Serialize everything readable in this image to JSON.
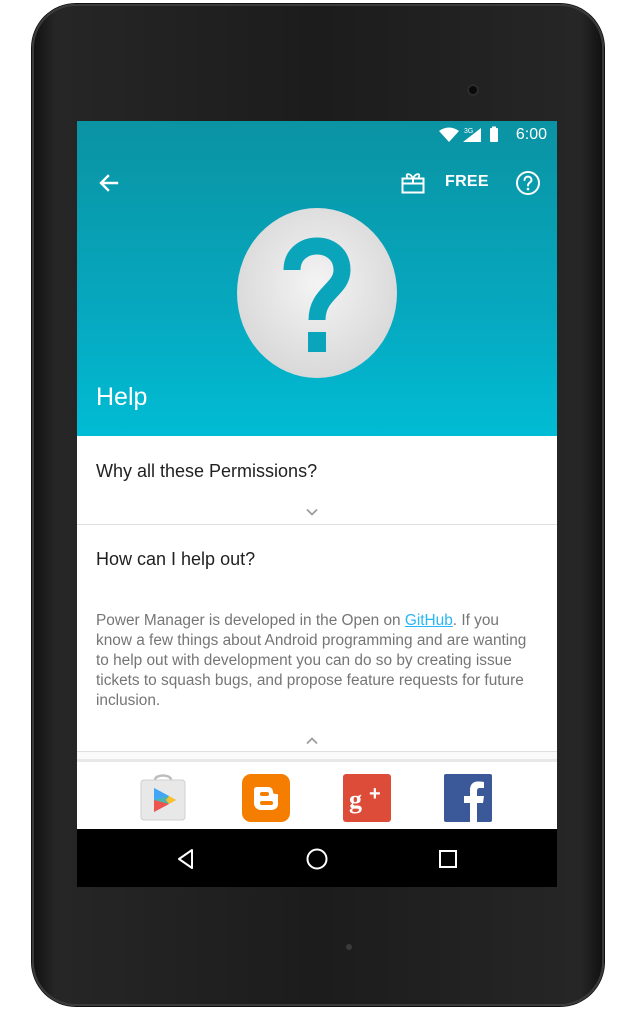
{
  "status_bar": {
    "network_label": "3G",
    "time": "6:00"
  },
  "toolbar": {
    "free_label": "FREE",
    "icons": [
      "back-arrow-icon",
      "gift-icon",
      "help-circle-icon"
    ]
  },
  "header": {
    "title": "Help",
    "hero_icon": "question-mark-icon"
  },
  "faq": [
    {
      "question": "Why all these Permissions?",
      "expanded": false
    },
    {
      "question": "How can I help out?",
      "expanded": true,
      "answer_before_link": "Power Manager is developed in the Open on ",
      "answer_link": "GitHub",
      "answer_after_link": ". If you know a few things about Android programming and are wanting to help out with development you can do so by creating issue tickets to squash bugs, and propose feature requests for future inclusion."
    }
  ],
  "share_apps": [
    "google-play-icon",
    "blogger-icon",
    "google-plus-icon",
    "facebook-icon"
  ],
  "nav_bar": [
    "back-triangle-icon",
    "home-circle-icon",
    "recents-square-icon"
  ],
  "colors": {
    "header_top": "#0a93a3",
    "header_bottom": "#00bcd4",
    "link": "#29b6f6",
    "blogger": "#f57d00",
    "google_plus": "#dd4b39",
    "facebook": "#3b5998"
  }
}
